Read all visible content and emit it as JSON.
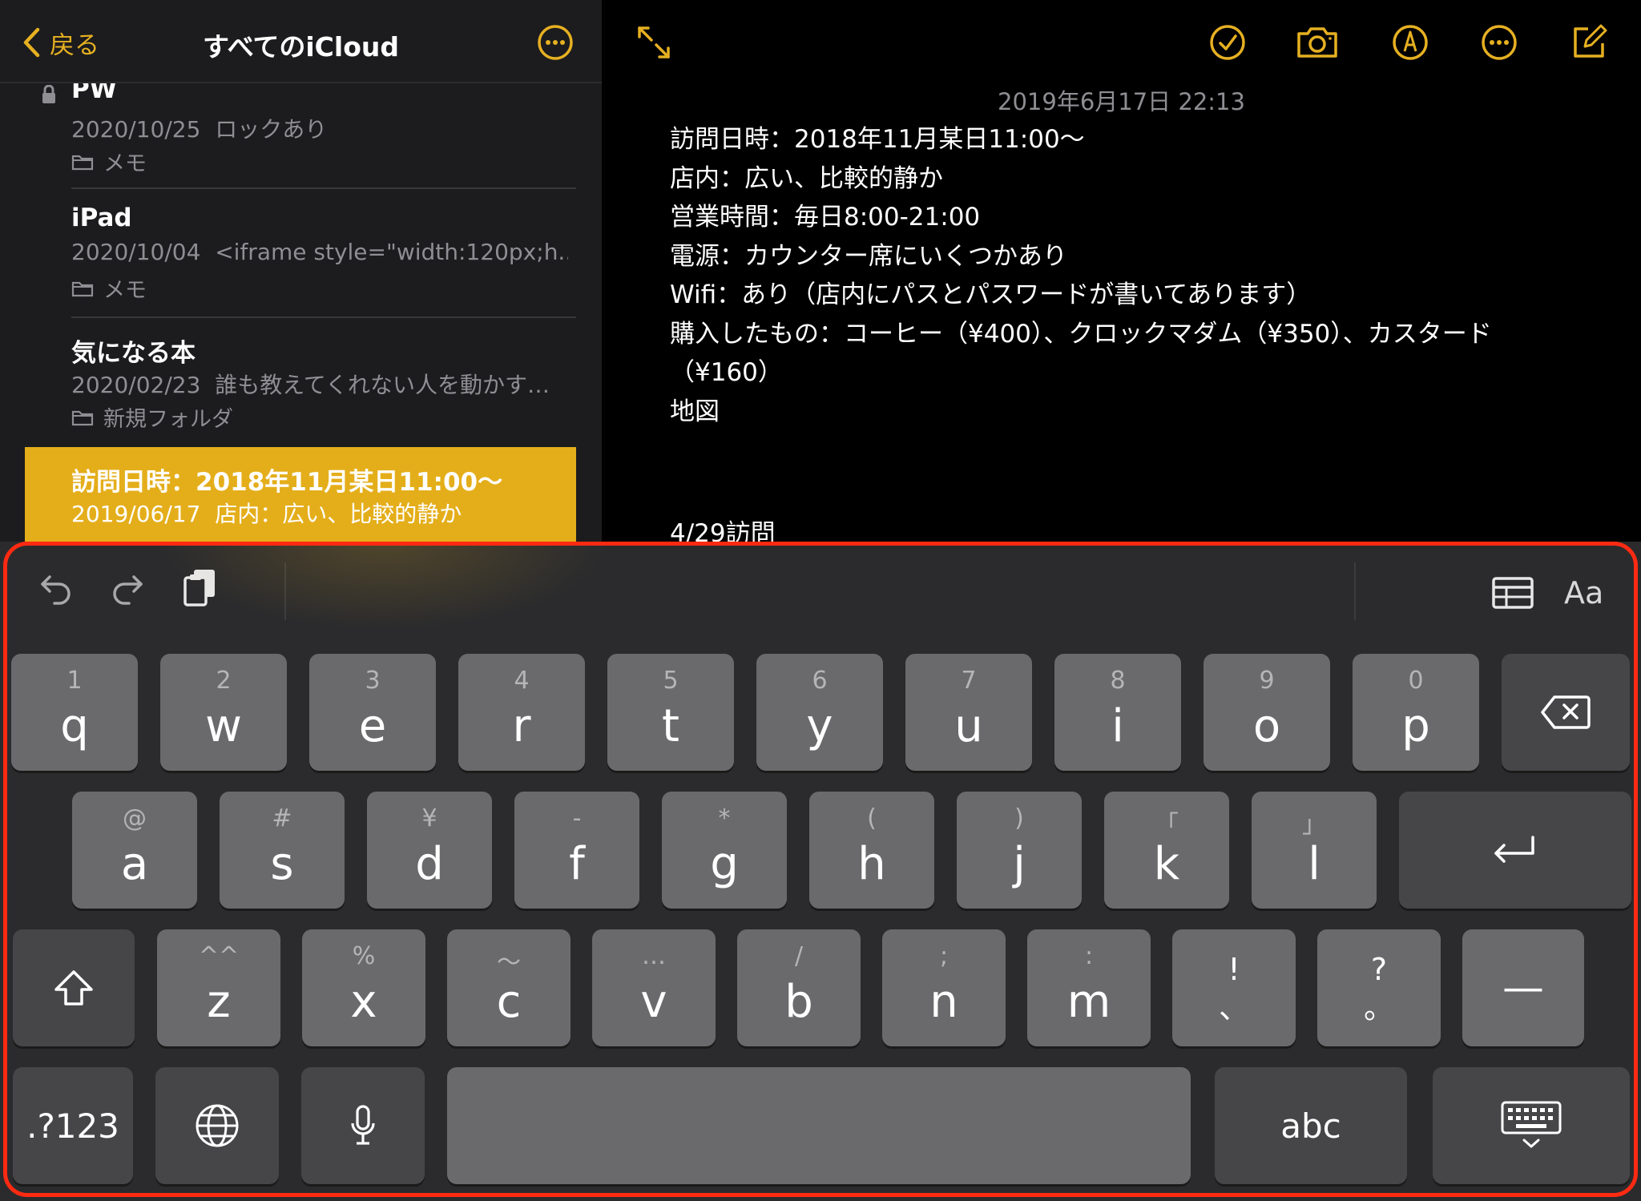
{
  "sidebar": {
    "back_label": "戻る",
    "title": "すべてのiCloud",
    "notes": [
      {
        "title": "PW",
        "date": "2020/10/25",
        "preview": "ロックあり",
        "folder": "メモ",
        "locked": true
      },
      {
        "title": "iPad",
        "date": "2020/10/04",
        "preview": "<iframe style=\"width:120px;h...",
        "folder": "メモ",
        "locked": false
      },
      {
        "title": "気になる本",
        "date": "2020/02/23",
        "preview": "誰も教えてくれない人を動かす…",
        "folder": "新規フォルダ",
        "locked": false
      },
      {
        "title": "訪問日時：2018年11月某日11:00〜",
        "date": "2019/06/17",
        "preview": "店内：広い、比較的静か",
        "folder": "",
        "locked": false,
        "selected": true
      }
    ]
  },
  "editor": {
    "toolbar_icons": [
      "expand-icon",
      "checklist-icon",
      "camera-icon",
      "markup-icon",
      "more-icon",
      "compose-icon"
    ],
    "date": "2019年6月17日 22:13",
    "lines": [
      "訪問日時：2018年11月某日11:00〜",
      "店内：広い、比較的静か",
      "営業時間：毎日8:00-21:00",
      "電源：カウンター席にいくつかあり",
      "Wifi：あり（店内にパスとパスワードが書いてあります）",
      "購入したもの：コーヒー（¥400）、クロックマダム（¥350）、カスタード",
      "（¥160）",
      "地図",
      "",
      "",
      ""
    ],
    "cut_line": "4/29訪問"
  },
  "keyboard": {
    "toolbar": {
      "format_label": "Aa"
    },
    "row1": [
      {
        "sub": "1",
        "main": "q"
      },
      {
        "sub": "2",
        "main": "w"
      },
      {
        "sub": "3",
        "main": "e"
      },
      {
        "sub": "4",
        "main": "r"
      },
      {
        "sub": "5",
        "main": "t"
      },
      {
        "sub": "6",
        "main": "y"
      },
      {
        "sub": "7",
        "main": "u"
      },
      {
        "sub": "8",
        "main": "i"
      },
      {
        "sub": "9",
        "main": "o"
      },
      {
        "sub": "0",
        "main": "p"
      }
    ],
    "row2": [
      {
        "sub": "@",
        "main": "a"
      },
      {
        "sub": "#",
        "main": "s"
      },
      {
        "sub": "¥",
        "main": "d"
      },
      {
        "sub": "-",
        "main": "f"
      },
      {
        "sub": "*",
        "main": "g"
      },
      {
        "sub": "(",
        "main": "h"
      },
      {
        "sub": ")",
        "main": "j"
      },
      {
        "sub": "「",
        "main": "k"
      },
      {
        "sub": "」",
        "main": "l"
      }
    ],
    "row3": [
      {
        "sub": "^^",
        "main": "z"
      },
      {
        "sub": "%",
        "main": "x"
      },
      {
        "sub": "〜",
        "main": "c"
      },
      {
        "sub": "…",
        "main": "v"
      },
      {
        "sub": "/",
        "main": "b"
      },
      {
        "sub": ";",
        "main": "n"
      },
      {
        "sub": ":",
        "main": "m"
      },
      {
        "top": "!",
        "bottom": "、"
      },
      {
        "top": "?",
        "bottom": "。"
      }
    ],
    "dash_label": "—",
    "numbers_label": ".?123",
    "abc_label": "abc"
  },
  "colors": {
    "accent": "#e6b021",
    "selected_row": "#e4ae1b",
    "highlight_frame": "#ff2a12"
  }
}
